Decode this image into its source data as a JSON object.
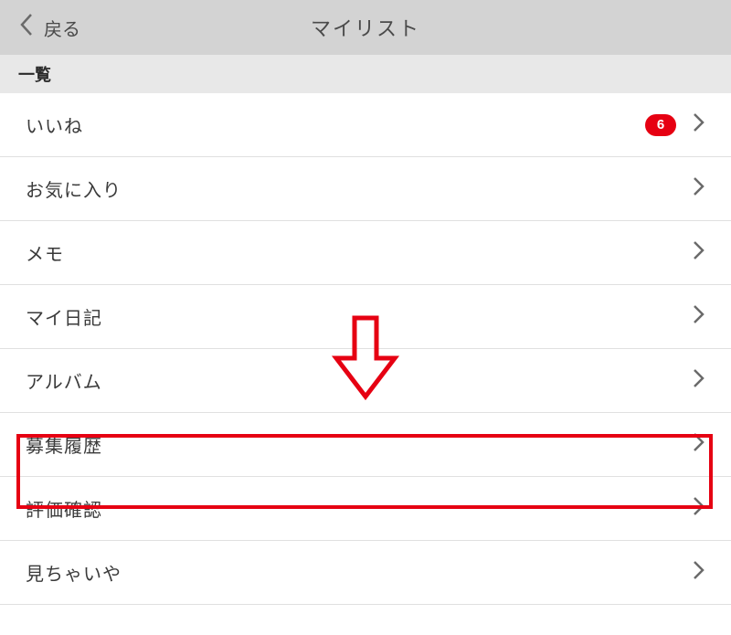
{
  "header": {
    "back_label": "戻る",
    "title": "マイリスト"
  },
  "section": {
    "title": "一覧"
  },
  "list": {
    "items": [
      {
        "label": "いいね",
        "badge": "6"
      },
      {
        "label": "お気に入り"
      },
      {
        "label": "メモ"
      },
      {
        "label": "マイ日記"
      },
      {
        "label": "アルバム"
      },
      {
        "label": "募集履歴"
      },
      {
        "label": "評価確認"
      },
      {
        "label": "見ちゃいや"
      }
    ]
  },
  "colors": {
    "accent": "#e60012",
    "header_bg": "#d3d3d3",
    "section_bg": "#e8e8e8"
  }
}
